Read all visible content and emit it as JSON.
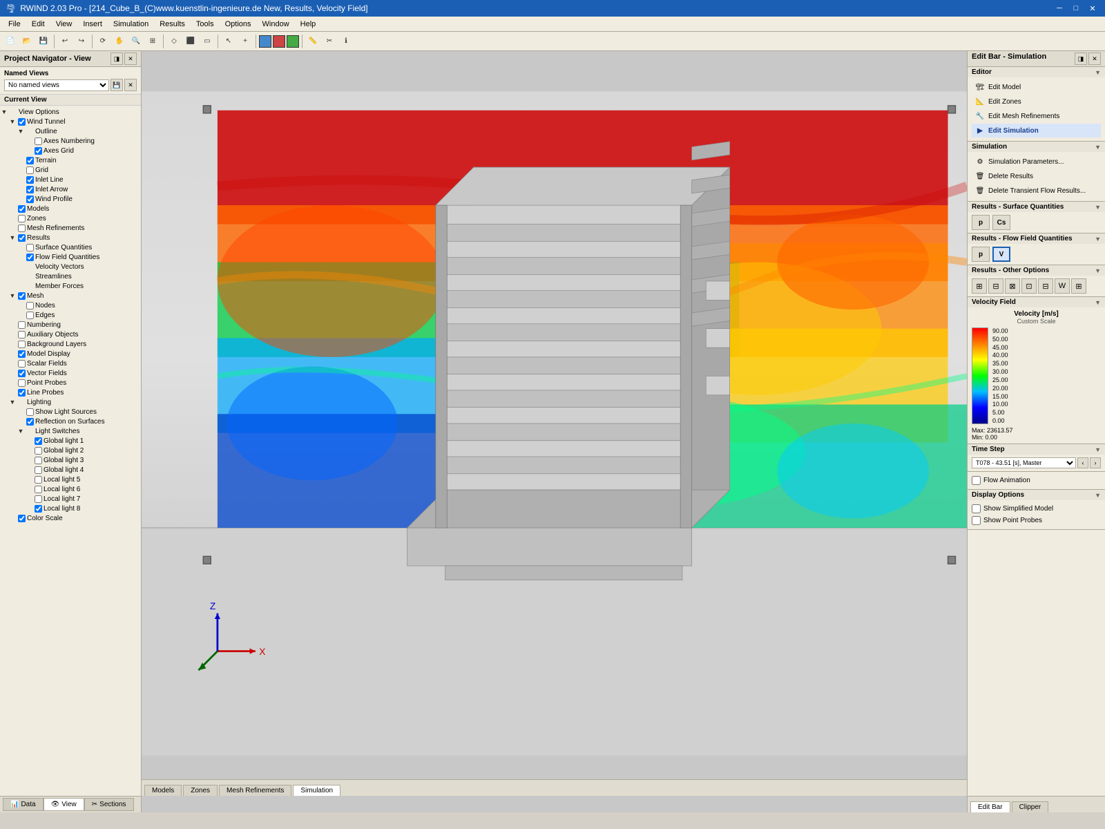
{
  "titleBar": {
    "title": "RWIND 2.03 Pro - [214_Cube_B_(C)www.kuenstlin-ingenieure.de New, Results, Velocity Field]",
    "minBtn": "─",
    "maxBtn": "□",
    "closeBtn": "✕"
  },
  "menuBar": {
    "items": [
      "File",
      "Edit",
      "View",
      "Insert",
      "Simulation",
      "Results",
      "Tools",
      "Options",
      "Window",
      "Help"
    ]
  },
  "leftPanel": {
    "header": "Project Navigator - View",
    "namedViews": {
      "label": "Named Views",
      "placeholder": "No named views"
    },
    "currentView": "Current View",
    "tree": [
      {
        "id": "view-options",
        "label": "View Options",
        "level": 0,
        "expanded": true,
        "hasCheckbox": false,
        "checked": false
      },
      {
        "id": "wind-tunnel",
        "label": "Wind Tunnel",
        "level": 1,
        "expanded": true,
        "hasCheckbox": true,
        "checked": true
      },
      {
        "id": "outline",
        "label": "Outline",
        "level": 2,
        "expanded": true,
        "hasCheckbox": false,
        "checked": false
      },
      {
        "id": "axes-numbering",
        "label": "Axes Numbering",
        "level": 3,
        "hasCheckbox": true,
        "checked": false
      },
      {
        "id": "axes-grid",
        "label": "Axes Grid",
        "level": 3,
        "hasCheckbox": true,
        "checked": true
      },
      {
        "id": "terrain",
        "label": "Terrain",
        "level": 2,
        "hasCheckbox": true,
        "checked": true
      },
      {
        "id": "grid",
        "label": "Grid",
        "level": 2,
        "hasCheckbox": true,
        "checked": false
      },
      {
        "id": "inlet-line",
        "label": "Inlet Line",
        "level": 2,
        "hasCheckbox": true,
        "checked": true
      },
      {
        "id": "inlet-arrow",
        "label": "Inlet Arrow",
        "level": 2,
        "hasCheckbox": true,
        "checked": true
      },
      {
        "id": "wind-profile",
        "label": "Wind Profile",
        "level": 2,
        "hasCheckbox": true,
        "checked": true
      },
      {
        "id": "models",
        "label": "Models",
        "level": 1,
        "hasCheckbox": true,
        "checked": true
      },
      {
        "id": "zones",
        "label": "Zones",
        "level": 1,
        "hasCheckbox": true,
        "checked": false
      },
      {
        "id": "mesh-refinements",
        "label": "Mesh Refinements",
        "level": 1,
        "hasCheckbox": true,
        "checked": false
      },
      {
        "id": "results",
        "label": "Results",
        "level": 1,
        "expanded": true,
        "hasCheckbox": true,
        "checked": true
      },
      {
        "id": "surface-quantities",
        "label": "Surface Quantities",
        "level": 2,
        "hasCheckbox": true,
        "checked": false
      },
      {
        "id": "flow-field-quantities",
        "label": "Flow Field Quantities",
        "level": 2,
        "hasCheckbox": true,
        "checked": true
      },
      {
        "id": "velocity-vectors",
        "label": "Velocity Vectors",
        "level": 2,
        "hasCheckbox": false,
        "checked": false
      },
      {
        "id": "streamlines",
        "label": "Streamlines",
        "level": 2,
        "hasCheckbox": false,
        "checked": false
      },
      {
        "id": "member-forces",
        "label": "Member Forces",
        "level": 2,
        "hasCheckbox": false,
        "checked": false
      },
      {
        "id": "mesh",
        "label": "Mesh",
        "level": 1,
        "expanded": true,
        "hasCheckbox": true,
        "checked": true
      },
      {
        "id": "nodes",
        "label": "Nodes",
        "level": 2,
        "hasCheckbox": true,
        "checked": false
      },
      {
        "id": "edges",
        "label": "Edges",
        "level": 2,
        "hasCheckbox": true,
        "checked": false
      },
      {
        "id": "numbering",
        "label": "Numbering",
        "level": 1,
        "hasCheckbox": true,
        "checked": false
      },
      {
        "id": "auxiliary-objects",
        "label": "Auxiliary Objects",
        "level": 1,
        "hasCheckbox": true,
        "checked": false
      },
      {
        "id": "background-layers",
        "label": "Background Layers",
        "level": 1,
        "hasCheckbox": true,
        "checked": false
      },
      {
        "id": "model-display",
        "label": "Model Display",
        "level": 1,
        "hasCheckbox": true,
        "checked": true
      },
      {
        "id": "scalar-fields",
        "label": "Scalar Fields",
        "level": 1,
        "hasCheckbox": true,
        "checked": false
      },
      {
        "id": "vector-fields",
        "label": "Vector Fields",
        "level": 1,
        "hasCheckbox": true,
        "checked": true
      },
      {
        "id": "point-probes",
        "label": "Point Probes",
        "level": 1,
        "hasCheckbox": true,
        "checked": false
      },
      {
        "id": "line-probes",
        "label": "Line Probes",
        "level": 1,
        "hasCheckbox": true,
        "checked": true
      },
      {
        "id": "lighting",
        "label": "Lighting",
        "level": 1,
        "expanded": true,
        "hasCheckbox": false,
        "checked": false
      },
      {
        "id": "show-light-sources",
        "label": "Show Light Sources",
        "level": 2,
        "hasCheckbox": true,
        "checked": false
      },
      {
        "id": "reflection-on-surfaces",
        "label": "Reflection on Surfaces",
        "level": 2,
        "hasCheckbox": true,
        "checked": true
      },
      {
        "id": "light-switches",
        "label": "Light Switches",
        "level": 2,
        "expanded": true,
        "hasCheckbox": false,
        "checked": false
      },
      {
        "id": "global-light-1",
        "label": "Global light 1",
        "level": 3,
        "hasCheckbox": true,
        "checked": true
      },
      {
        "id": "global-light-2",
        "label": "Global light 2",
        "level": 3,
        "hasCheckbox": true,
        "checked": false
      },
      {
        "id": "global-light-3",
        "label": "Global light 3",
        "level": 3,
        "hasCheckbox": true,
        "checked": false
      },
      {
        "id": "global-light-4",
        "label": "Global light 4",
        "level": 3,
        "hasCheckbox": true,
        "checked": false
      },
      {
        "id": "local-light-5",
        "label": "Local light 5",
        "level": 3,
        "hasCheckbox": true,
        "checked": false
      },
      {
        "id": "local-light-6",
        "label": "Local light 6",
        "level": 3,
        "hasCheckbox": true,
        "checked": false
      },
      {
        "id": "local-light-7",
        "label": "Local light 7",
        "level": 3,
        "hasCheckbox": true,
        "checked": false
      },
      {
        "id": "local-light-8",
        "label": "Local light 8",
        "level": 3,
        "hasCheckbox": true,
        "checked": true
      },
      {
        "id": "color-scale",
        "label": "Color Scale",
        "level": 1,
        "hasCheckbox": true,
        "checked": true
      }
    ]
  },
  "rightPanel": {
    "header": "Edit Bar - Simulation",
    "editorSection": {
      "title": "Editor",
      "items": [
        {
          "id": "edit-model",
          "label": "Edit Model"
        },
        {
          "id": "edit-zones",
          "label": "Edit Zones"
        },
        {
          "id": "edit-mesh-refinements",
          "label": "Edit Mesh Refinements"
        },
        {
          "id": "edit-simulation",
          "label": "Edit Simulation",
          "active": true
        }
      ]
    },
    "simulationSection": {
      "title": "Simulation",
      "items": [
        {
          "id": "simulation-parameters",
          "label": "Simulation Parameters..."
        },
        {
          "id": "delete-results",
          "label": "Delete Results"
        },
        {
          "id": "delete-transient",
          "label": "Delete Transient Flow Results..."
        }
      ]
    },
    "resultsSurface": {
      "title": "Results - Surface Quantities",
      "buttons": [
        "P",
        "Cs"
      ]
    },
    "resultsFlow": {
      "title": "Results - Flow Field Quantities",
      "buttons": [
        "P",
        "V"
      ],
      "activeBtn": "V"
    },
    "resultsOther": {
      "title": "Results - Other Options",
      "buttons": [
        "⊞",
        "⊟",
        "⊠",
        "⊡",
        "⊟",
        "W",
        "⊞"
      ]
    },
    "velocityField": {
      "title": "Velocity Field",
      "legendTitle": "Velocity [m/s]",
      "legendSubtitle": "Custom Scale",
      "values": [
        "90.00",
        "50.00",
        "45.00",
        "40.00",
        "35.00",
        "30.00",
        "25.00",
        "20.00",
        "15.00",
        "10.00",
        "5.00",
        "0.00"
      ],
      "maxLabel": "Max:",
      "maxValue": "23613.57",
      "minLabel": "Min:",
      "minValue": "0.00"
    },
    "timeStep": {
      "title": "Time Step",
      "value": "T078 - 43.51 [s], Master"
    },
    "flowAnimation": {
      "label": "Flow Animation"
    },
    "displayOptions": {
      "title": "Display Options",
      "items": [
        {
          "id": "show-simplified",
          "label": "Show Simplified Model",
          "checked": false
        },
        {
          "id": "show-point-probes",
          "label": "Show Point Probes",
          "checked": false
        }
      ]
    }
  },
  "viewportTabs": {
    "tabs": [
      {
        "id": "models-tab",
        "label": "Models",
        "active": false
      },
      {
        "id": "zones-tab",
        "label": "Zones",
        "active": false
      },
      {
        "id": "mesh-tab",
        "label": "Mesh Refinements",
        "active": false
      },
      {
        "id": "simulation-tab",
        "label": "Simulation",
        "active": true
      }
    ]
  },
  "bottomTabs": {
    "tabs": [
      {
        "id": "data-tab",
        "label": "Data",
        "icon": "📊"
      },
      {
        "id": "view-tab",
        "label": "View",
        "icon": "👁",
        "active": true
      },
      {
        "id": "sections-tab",
        "label": "Sections",
        "icon": "✂"
      }
    ]
  },
  "rightBottomTabs": {
    "tabs": [
      {
        "id": "edit-bar-tab",
        "label": "Edit Bar",
        "active": true
      },
      {
        "id": "clipper-tab",
        "label": "Clipper"
      }
    ]
  }
}
